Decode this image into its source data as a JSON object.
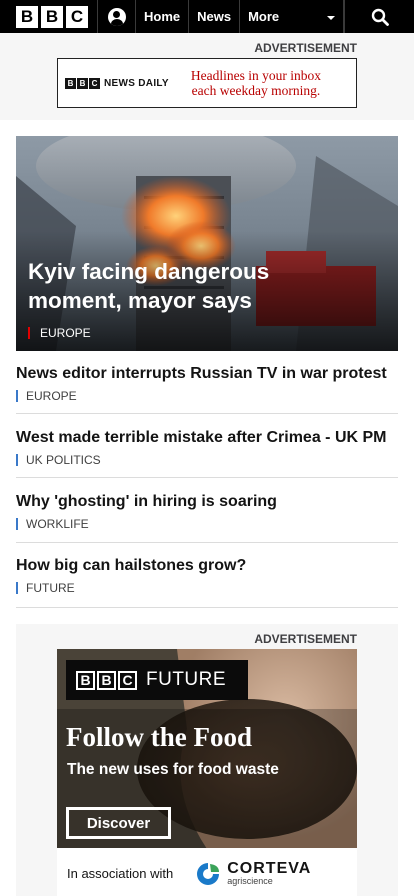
{
  "nav": {
    "logo_letters": [
      "B",
      "B",
      "C"
    ],
    "account_icon": "account-icon",
    "home_label": "Home",
    "news_label": "News",
    "more_label": "More",
    "search_icon": "search-icon"
  },
  "ad_top": {
    "label": "ADVERTISEMENT",
    "brand_letters": [
      "B",
      "B",
      "C"
    ],
    "brand_text": "NEWS DAILY",
    "headline_line1": "Headlines in your inbox",
    "headline_line2": "each weekday morning."
  },
  "lead_story": {
    "headline": "Kyiv facing dangerous moment, mayor says",
    "tag": "EUROPE",
    "tag_color": "#e10000"
  },
  "stories": [
    {
      "headline": "News editor interrupts Russian TV in war protest",
      "tag": "EUROPE"
    },
    {
      "headline": "West made terrible mistake after Crimea - UK PM",
      "tag": "UK POLITICS"
    },
    {
      "headline": "Why 'ghosting' in hiring is soaring",
      "tag": "WORKLIFE"
    },
    {
      "headline": "How big can hailstones grow?",
      "tag": "FUTURE"
    }
  ],
  "ad_bottom": {
    "label": "ADVERTISEMENT",
    "brand_letters": [
      "B",
      "B",
      "C"
    ],
    "brand_text": "FUTURE",
    "title": "Follow the Food",
    "subtitle": "The new uses for food waste",
    "button_label": "Discover",
    "assoc_text": "In association with",
    "sponsor_name": "CORTEVA",
    "sponsor_sub": "agriscience"
  },
  "colors": {
    "topbar": "#000000",
    "accent_red": "#e10000",
    "tag_blue": "#3a79c9",
    "ad_headline_red": "#b80000"
  }
}
